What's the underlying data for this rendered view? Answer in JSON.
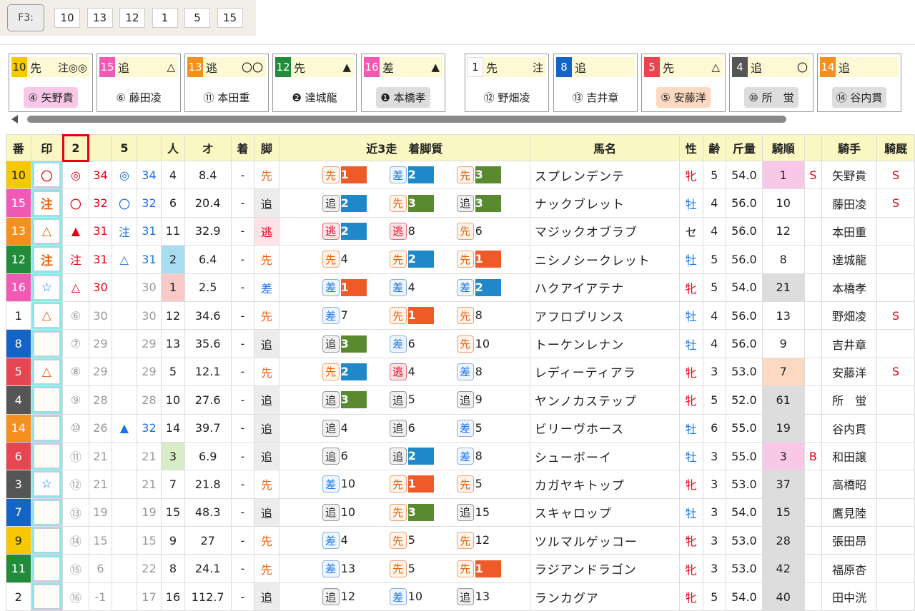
{
  "topbar": {
    "f3_label": "F3:",
    "numbers": [
      "10",
      "13",
      "12",
      "1",
      "5",
      "15"
    ]
  },
  "cards": [
    {
      "num": "10",
      "num_color": "#f5c800",
      "run": "先",
      "marks": "注◎◎",
      "jockey": "④ 矢野貴",
      "jk_bg": "#f9c8e8"
    },
    {
      "num": "15",
      "num_color": "#f05ab4",
      "run": "追",
      "marks": "△",
      "jockey": "⑥ 藤田凌",
      "jk_bg": "#ffffff"
    },
    {
      "num": "13",
      "num_color": "#f5901e",
      "run": "逃",
      "marks": "〇〇",
      "jockey": "⑪ 本田重",
      "jk_bg": "#ffffff"
    },
    {
      "num": "12",
      "num_color": "#228b3c",
      "run": "先",
      "marks": "▲",
      "jockey": "❷ 達城龍",
      "jk_bg": "#ffffff"
    },
    {
      "num": "16",
      "num_color": "#f05ab4",
      "run": "差",
      "marks": "▲",
      "jockey": "❶ 本橋孝",
      "jk_bg": "#dddddd"
    },
    {
      "num": "1",
      "num_color": "#ffffff",
      "run": "先",
      "marks": "注",
      "jockey": "⑫ 野畑凌",
      "jk_bg": "#ffffff"
    },
    {
      "num": "8",
      "num_color": "#1464c8",
      "run": "追",
      "marks": "",
      "jockey": "⑬ 吉井章",
      "jk_bg": "#ffffff"
    },
    {
      "num": "5",
      "num_color": "#e64650",
      "run": "先",
      "marks": "△",
      "jockey": "⑤ 安藤洋",
      "jk_bg": "#fcd9c0"
    },
    {
      "num": "4",
      "num_color": "#555555",
      "run": "追",
      "marks": "〇",
      "jockey": "⑩ 所　蛍",
      "jk_bg": "#dddddd"
    },
    {
      "num": "14",
      "num_color": "#f5901e",
      "run": "追",
      "marks": "",
      "jockey": "⑭ 谷内貫",
      "jk_bg": "#dddddd"
    }
  ],
  "headers": [
    "番",
    "印",
    "2",
    "",
    "5",
    "",
    "人",
    "オ",
    "着",
    "脚",
    "近3走　着脚質",
    "馬名",
    "性",
    "齢",
    "斤量",
    "騎順",
    "",
    "騎手",
    "騎厩"
  ],
  "rows": [
    {
      "no": "10",
      "noc": "#f5c800",
      "mark": "〇",
      "m2": "◎",
      "m2c": "red",
      "v2": "34",
      "v2c": "red",
      "m5": "◎",
      "m5c": "blue",
      "v5": "34",
      "v5c": "blue",
      "ninki": "4",
      "nk": "",
      "odds": "8.4",
      "chaku": "-",
      "ashi": "先",
      "ashic": "orange",
      "ashibg": "",
      "r": [
        [
          "先",
          "o",
          "1",
          "c1"
        ],
        [
          "差",
          "b",
          "2",
          "c2"
        ],
        [
          "先",
          "o",
          "3",
          "c3"
        ]
      ],
      "name": "スプレンデンテ",
      "sex": "牝",
      "age": "5",
      "kin": "54.0",
      "kj": "1",
      "kjbg": "#f9c8e8",
      "s": "S",
      "jockey": "矢野貴",
      "kyu": "S"
    },
    {
      "no": "15",
      "noc": "#f05ab4",
      "mark": "注",
      "m2": "〇",
      "m2c": "red",
      "v2": "32",
      "v2c": "red",
      "m5": "〇",
      "m5c": "blue",
      "v5": "32",
      "v5c": "blue",
      "ninki": "6",
      "nk": "",
      "odds": "20.4",
      "chaku": "-",
      "ashi": "追",
      "ashic": "",
      "ashibg": "",
      "r": [
        [
          "追",
          "g",
          "2",
          "c2"
        ],
        [
          "先",
          "o",
          "3",
          "c3"
        ],
        [
          "追",
          "g",
          "3",
          "c3"
        ]
      ],
      "name": "ナックブレット",
      "sex": "牡",
      "age": "4",
      "kin": "56.0",
      "kj": "10",
      "kjbg": "",
      "s": "",
      "jockey": "藤田凌",
      "kyu": "S"
    },
    {
      "no": "13",
      "noc": "#f5901e",
      "mark": "△",
      "m2": "▲",
      "m2c": "red",
      "v2": "31",
      "v2c": "red",
      "m5": "注",
      "m5c": "blue",
      "v5": "31",
      "v5c": "blue",
      "ninki": "11",
      "nk": "",
      "odds": "32.9",
      "chaku": "-",
      "ashi": "逃",
      "ashic": "red",
      "ashibg": "#fde2e8",
      "r": [
        [
          "逃",
          "p",
          "2",
          "c2"
        ],
        [
          "逃",
          "p",
          "8",
          ""
        ],
        [
          "先",
          "o",
          "6",
          ""
        ]
      ],
      "name": "マジックオブラブ",
      "sex": "セ",
      "age": "4",
      "kin": "56.0",
      "kj": "12",
      "kjbg": "",
      "s": "",
      "jockey": "本田重",
      "kyu": ""
    },
    {
      "no": "12",
      "noc": "#228b3c",
      "mark": "注",
      "m2": "注",
      "m2c": "red",
      "v2": "31",
      "v2c": "red",
      "m5": "△",
      "m5c": "blue",
      "v5": "31",
      "v5c": "blue",
      "ninki": "2",
      "nk": "#a8dcf0",
      "odds": "6.4",
      "chaku": "-",
      "ashi": "先",
      "ashic": "orange",
      "ashibg": "",
      "r": [
        [
          "先",
          "o",
          "4",
          ""
        ],
        [
          "先",
          "o",
          "2",
          "c2"
        ],
        [
          "先",
          "o",
          "1",
          "c1"
        ]
      ],
      "name": "ニシノシークレット",
      "sex": "牡",
      "age": "5",
      "kin": "56.0",
      "kj": "8",
      "kjbg": "",
      "s": "",
      "jockey": "達城龍",
      "kyu": ""
    },
    {
      "no": "16",
      "noc": "#f05ab4",
      "mark": "☆",
      "m2": "△",
      "m2c": "red",
      "v2": "30",
      "v2c": "red",
      "m5": "",
      "m5c": "",
      "v5": "30",
      "v5c": "gray",
      "ninki": "1",
      "nk": "#f9c8c8",
      "odds": "2.5",
      "chaku": "-",
      "ashi": "差",
      "ashic": "blue",
      "ashibg": "",
      "r": [
        [
          "差",
          "b",
          "1",
          "c1"
        ],
        [
          "差",
          "b",
          "4",
          ""
        ],
        [
          "差",
          "b",
          "2",
          "c2"
        ]
      ],
      "name": "ハクアイアテナ",
      "sex": "牝",
      "age": "5",
      "kin": "54.0",
      "kj": "21",
      "kjbg": "#dddddd",
      "s": "",
      "jockey": "本橋孝",
      "kyu": ""
    },
    {
      "no": "1",
      "noc": "#ffffff",
      "mark": "△",
      "m2": "⑥",
      "m2c": "gray",
      "v2": "30",
      "v2c": "gray",
      "m5": "",
      "m5c": "",
      "v5": "30",
      "v5c": "gray",
      "ninki": "12",
      "nk": "",
      "odds": "34.6",
      "chaku": "-",
      "ashi": "先",
      "ashic": "orange",
      "ashibg": "",
      "r": [
        [
          "差",
          "b",
          "7",
          ""
        ],
        [
          "先",
          "o",
          "1",
          "c1"
        ],
        [
          "先",
          "o",
          "8",
          ""
        ]
      ],
      "name": "アフロプリンス",
      "sex": "牡",
      "age": "4",
      "kin": "56.0",
      "kj": "13",
      "kjbg": "",
      "s": "",
      "jockey": "野畑凌",
      "kyu": "S"
    },
    {
      "no": "8",
      "noc": "#1464c8",
      "mark": "",
      "m2": "⑦",
      "m2c": "gray",
      "v2": "29",
      "v2c": "gray",
      "m5": "",
      "m5c": "",
      "v5": "29",
      "v5c": "gray",
      "ninki": "13",
      "nk": "",
      "odds": "35.6",
      "chaku": "-",
      "ashi": "追",
      "ashic": "",
      "ashibg": "",
      "r": [
        [
          "追",
          "g",
          "3",
          "c3"
        ],
        [
          "差",
          "b",
          "6",
          ""
        ],
        [
          "先",
          "o",
          "10",
          ""
        ]
      ],
      "name": "トーケンレナン",
      "sex": "牡",
      "age": "4",
      "kin": "56.0",
      "kj": "9",
      "kjbg": "",
      "s": "",
      "jockey": "吉井章",
      "kyu": ""
    },
    {
      "no": "5",
      "noc": "#e64650",
      "mark": "△",
      "m2": "⑧",
      "m2c": "gray",
      "v2": "29",
      "v2c": "gray",
      "m5": "",
      "m5c": "",
      "v5": "29",
      "v5c": "gray",
      "ninki": "5",
      "nk": "",
      "odds": "12.1",
      "chaku": "-",
      "ashi": "先",
      "ashic": "orange",
      "ashibg": "",
      "r": [
        [
          "先",
          "o",
          "2",
          "c2"
        ],
        [
          "逃",
          "p",
          "4",
          ""
        ],
        [
          "差",
          "b",
          "8",
          ""
        ]
      ],
      "name": "レディーティアラ",
      "sex": "牝",
      "age": "3",
      "kin": "53.0",
      "kj": "7",
      "kjbg": "#fcd9c0",
      "s": "",
      "jockey": "安藤洋",
      "kyu": "S"
    },
    {
      "no": "4",
      "noc": "#555555",
      "mark": "",
      "m2": "⑨",
      "m2c": "gray",
      "v2": "28",
      "v2c": "gray",
      "m5": "",
      "m5c": "",
      "v5": "28",
      "v5c": "gray",
      "ninki": "10",
      "nk": "",
      "odds": "27.6",
      "chaku": "-",
      "ashi": "追",
      "ashic": "",
      "ashibg": "",
      "r": [
        [
          "追",
          "g",
          "3",
          "c3"
        ],
        [
          "追",
          "g",
          "5",
          ""
        ],
        [
          "追",
          "g",
          "9",
          ""
        ]
      ],
      "name": "ヤンノカステップ",
      "sex": "牝",
      "age": "5",
      "kin": "52.0",
      "kj": "61",
      "kjbg": "#dddddd",
      "s": "",
      "jockey": "所　蛍",
      "kyu": ""
    },
    {
      "no": "14",
      "noc": "#f5901e",
      "mark": "",
      "m2": "⑩",
      "m2c": "gray",
      "v2": "26",
      "v2c": "gray",
      "m5": "▲",
      "m5c": "blue",
      "v5": "32",
      "v5c": "blue",
      "ninki": "14",
      "nk": "",
      "odds": "39.7",
      "chaku": "-",
      "ashi": "追",
      "ashic": "",
      "ashibg": "",
      "r": [
        [
          "追",
          "g",
          "4",
          ""
        ],
        [
          "追",
          "g",
          "6",
          ""
        ],
        [
          "差",
          "b",
          "5",
          ""
        ]
      ],
      "name": "ビリーヴホース",
      "sex": "牡",
      "age": "6",
      "kin": "55.0",
      "kj": "19",
      "kjbg": "#dddddd",
      "s": "",
      "jockey": "谷内貫",
      "kyu": ""
    },
    {
      "no": "6",
      "noc": "#e64650",
      "mark": "",
      "m2": "⑪",
      "m2c": "gray",
      "v2": "21",
      "v2c": "gray",
      "m5": "",
      "m5c": "",
      "v5": "21",
      "v5c": "gray",
      "ninki": "3",
      "nk": "#d8ecc8",
      "odds": "6.9",
      "chaku": "-",
      "ashi": "追",
      "ashic": "",
      "ashibg": "",
      "r": [
        [
          "追",
          "g",
          "6",
          ""
        ],
        [
          "追",
          "g",
          "2",
          "c2"
        ],
        [
          "差",
          "b",
          "8",
          ""
        ]
      ],
      "name": "シューボーイ",
      "sex": "牡",
      "age": "3",
      "kin": "55.0",
      "kj": "3",
      "kjbg": "#f9c8e8",
      "s": "B",
      "jockey": "和田譲",
      "kyu": ""
    },
    {
      "no": "3",
      "noc": "#555555",
      "mark": "☆",
      "m2": "⑫",
      "m2c": "gray",
      "v2": "21",
      "v2c": "gray",
      "m5": "",
      "m5c": "",
      "v5": "21",
      "v5c": "gray",
      "ninki": "7",
      "nk": "",
      "odds": "21.8",
      "chaku": "-",
      "ashi": "先",
      "ashic": "orange",
      "ashibg": "",
      "r": [
        [
          "差",
          "b",
          "10",
          ""
        ],
        [
          "先",
          "o",
          "1",
          "c1"
        ],
        [
          "先",
          "o",
          "5",
          ""
        ]
      ],
      "name": "カガヤキトップ",
      "sex": "牝",
      "age": "3",
      "kin": "53.0",
      "kj": "37",
      "kjbg": "#dddddd",
      "s": "",
      "jockey": "高橋昭",
      "kyu": ""
    },
    {
      "no": "7",
      "noc": "#1464c8",
      "mark": "",
      "m2": "⑬",
      "m2c": "gray",
      "v2": "19",
      "v2c": "gray",
      "m5": "",
      "m5c": "",
      "v5": "19",
      "v5c": "gray",
      "ninki": "15",
      "nk": "",
      "odds": "48.3",
      "chaku": "-",
      "ashi": "追",
      "ashic": "",
      "ashibg": "",
      "r": [
        [
          "追",
          "g",
          "10",
          ""
        ],
        [
          "先",
          "o",
          "3",
          "c3"
        ],
        [
          "追",
          "g",
          "15",
          ""
        ]
      ],
      "name": "スキャロップ",
      "sex": "牡",
      "age": "3",
      "kin": "54.0",
      "kj": "15",
      "kjbg": "#dddddd",
      "s": "",
      "jockey": "鷹見陸",
      "kyu": ""
    },
    {
      "no": "9",
      "noc": "#f5c800",
      "mark": "",
      "m2": "⑭",
      "m2c": "gray",
      "v2": "15",
      "v2c": "gray",
      "m5": "",
      "m5c": "",
      "v5": "15",
      "v5c": "gray",
      "ninki": "9",
      "nk": "",
      "odds": "27",
      "chaku": "-",
      "ashi": "先",
      "ashic": "orange",
      "ashibg": "",
      "r": [
        [
          "差",
          "b",
          "4",
          ""
        ],
        [
          "先",
          "o",
          "5",
          ""
        ],
        [
          "先",
          "o",
          "12",
          ""
        ]
      ],
      "name": "ツルマルゲッコー",
      "sex": "牝",
      "age": "3",
      "kin": "53.0",
      "kj": "28",
      "kjbg": "#dddddd",
      "s": "",
      "jockey": "張田昂",
      "kyu": ""
    },
    {
      "no": "11",
      "noc": "#228b3c",
      "mark": "",
      "m2": "⑮",
      "m2c": "gray",
      "v2": "6",
      "v2c": "gray",
      "m5": "",
      "m5c": "",
      "v5": "22",
      "v5c": "gray",
      "ninki": "8",
      "nk": "",
      "odds": "24.1",
      "chaku": "-",
      "ashi": "先",
      "ashic": "orange",
      "ashibg": "",
      "r": [
        [
          "差",
          "b",
          "13",
          ""
        ],
        [
          "先",
          "o",
          "5",
          ""
        ],
        [
          "先",
          "o",
          "1",
          "c1"
        ]
      ],
      "name": "ラジアンドラゴン",
      "sex": "牝",
      "age": "3",
      "kin": "53.0",
      "kj": "42",
      "kjbg": "#dddddd",
      "s": "",
      "jockey": "福原杏",
      "kyu": ""
    },
    {
      "no": "2",
      "noc": "#ffffff",
      "mark": "",
      "m2": "⑯",
      "m2c": "gray",
      "v2": "-1",
      "v2c": "gray",
      "m5": "",
      "m5c": "",
      "v5": "17",
      "v5c": "gray",
      "ninki": "16",
      "nk": "",
      "odds": "112.7",
      "chaku": "-",
      "ashi": "追",
      "ashic": "",
      "ashibg": "",
      "r": [
        [
          "追",
          "g",
          "12",
          ""
        ],
        [
          "差",
          "b",
          "10",
          ""
        ],
        [
          "追",
          "g",
          "13",
          ""
        ]
      ],
      "name": "ランカグア",
      "sex": "牝",
      "age": "5",
      "kin": "54.0",
      "kj": "40",
      "kjbg": "#dddddd",
      "s": "",
      "jockey": "田中洸",
      "kyu": ""
    }
  ]
}
